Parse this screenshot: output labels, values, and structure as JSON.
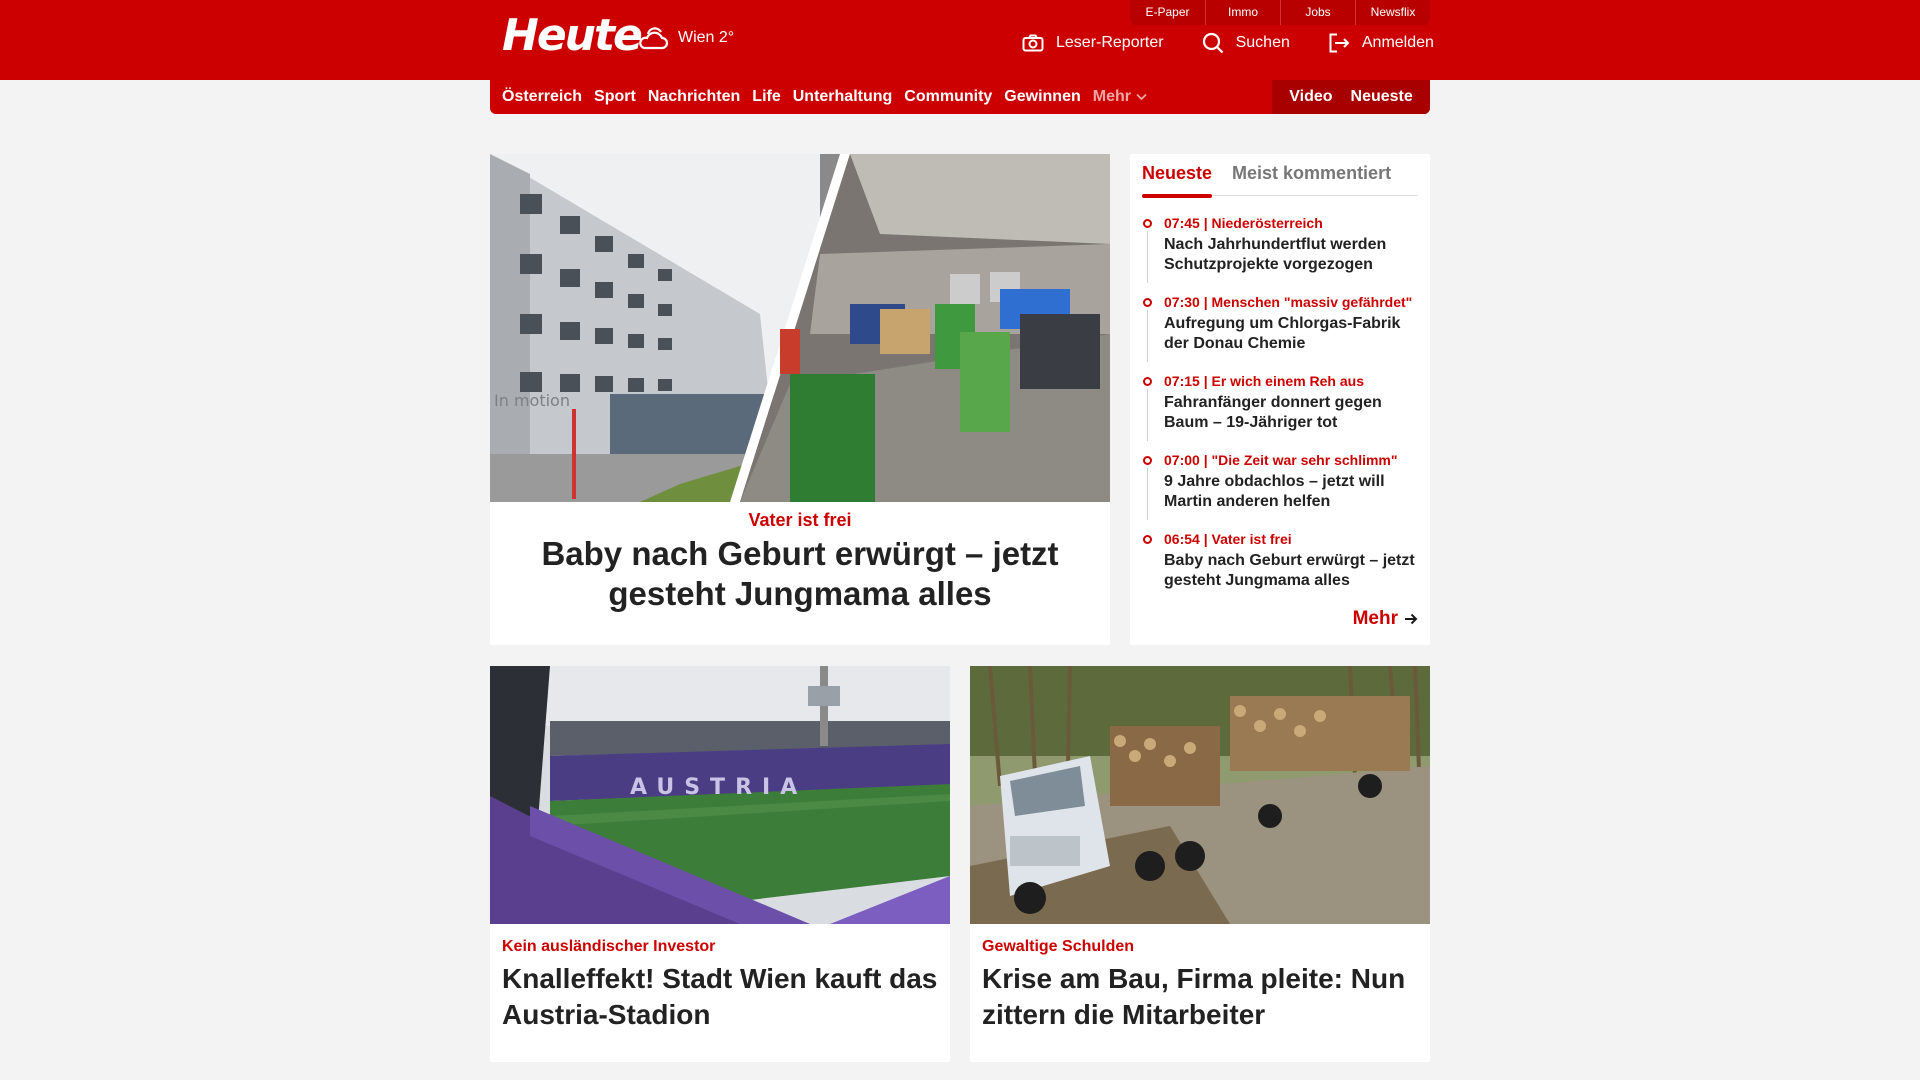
{
  "header": {
    "logo": "Heute",
    "weather": "Wien 2°",
    "service_links": [
      "E-Paper",
      "Immo",
      "Jobs",
      "Newsflix"
    ],
    "actions": [
      {
        "label": "Leser-Reporter",
        "icon": "camera-icon"
      },
      {
        "label": "Suchen",
        "icon": "search-icon"
      },
      {
        "label": "Anmelden",
        "icon": "login-icon"
      }
    ]
  },
  "nav": {
    "items": [
      "Österreich",
      "Sport",
      "Nachrichten",
      "Life",
      "Unterhaltung",
      "Community",
      "Gewinnen"
    ],
    "more": "Mehr",
    "right": [
      "Video",
      "Neueste"
    ]
  },
  "hero": {
    "kicker": "Vater ist frei",
    "title": "Baby nach Geburt erwürgt – jetzt gesteht Jungmama alles",
    "image_text": "In motion"
  },
  "sidebar": {
    "tabs": [
      "Neueste",
      "Meist kommentiert"
    ],
    "active_tab": "Neueste",
    "items": [
      {
        "meta": "07:45 | Niederösterreich",
        "title": "Nach Jahrhundertflut werden Schutzprojekte vorgezogen"
      },
      {
        "meta": "07:30 | Menschen \"massiv gefährdet\"",
        "title": "Aufregung um Chlorgas-Fabrik der Donau Chemie"
      },
      {
        "meta": "07:15 | Er wich einem Reh aus",
        "title": "Fahranfänger donnert gegen Baum – 19-Jähriger tot"
      },
      {
        "meta": "07:00 | \"Die Zeit war sehr schlimm\"",
        "title": "9 Jahre obdachlos – jetzt will Martin anderen helfen"
      },
      {
        "meta": "06:54 | Vater ist frei",
        "title": "Baby nach Geburt erwürgt – jetzt gesteht Jungmama alles"
      }
    ],
    "more": "Mehr"
  },
  "cards": [
    {
      "kicker": "Kein ausländischer Investor",
      "title": "Knalleffekt! Stadt Wien kauft das Austria-Stadion",
      "image_text": "AUSTRIA"
    },
    {
      "kicker": "Gewaltige Schulden",
      "title": "Krise am Bau, Firma pleite: Nun zittern die Mitarbeiter"
    }
  ],
  "colors": {
    "brand": "#cc0000",
    "background": "#f3f3f3"
  }
}
